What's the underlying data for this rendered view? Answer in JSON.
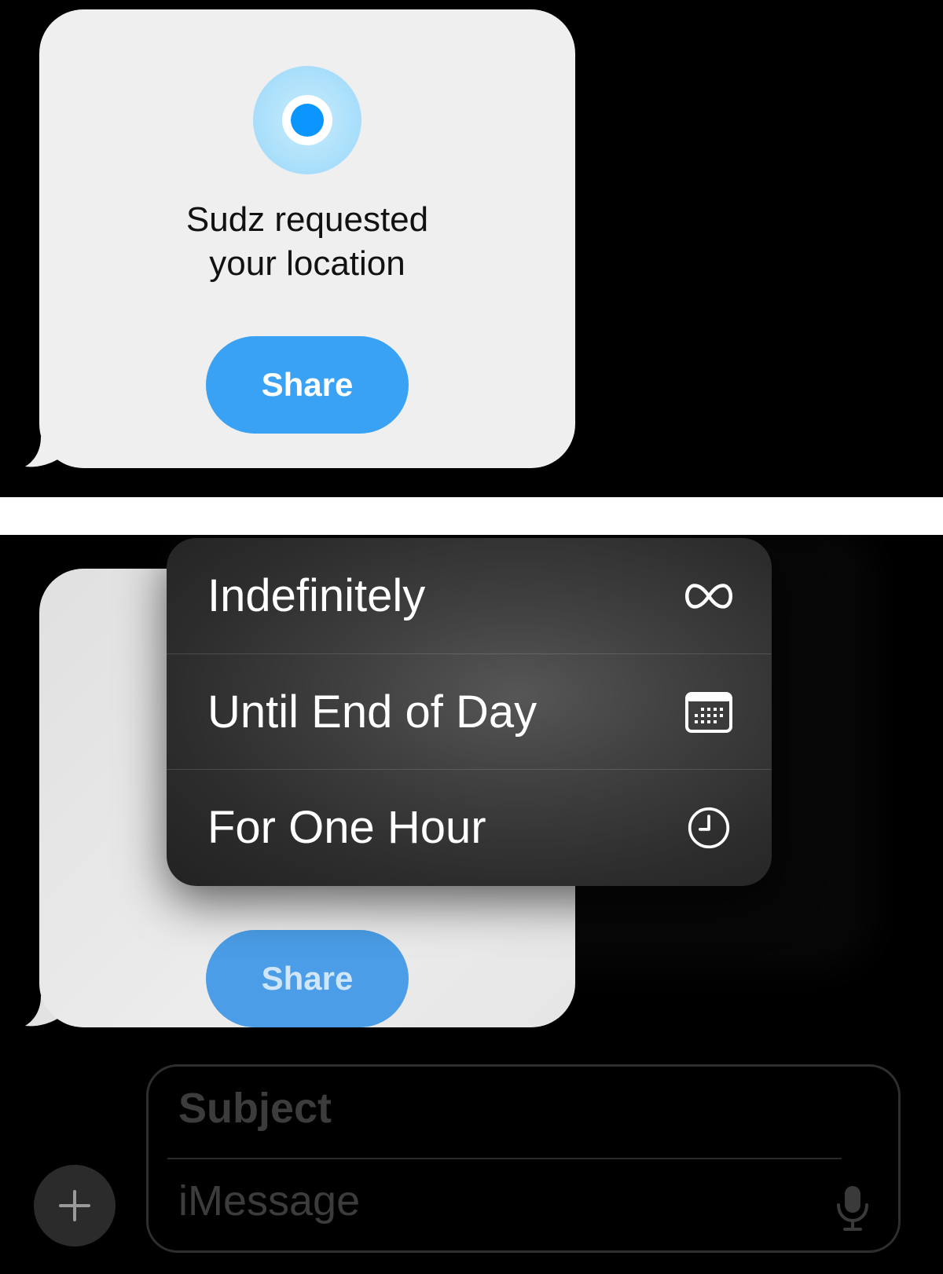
{
  "top_bubble": {
    "request_line1": "Sudz requested",
    "request_line2": "your location",
    "share_label": "Share"
  },
  "bottom_bubble": {
    "share_label": "Share"
  },
  "menu": {
    "items": [
      {
        "label": "Indefinitely",
        "icon": "infinity-icon"
      },
      {
        "label": "Until End of Day",
        "icon": "calendar-icon"
      },
      {
        "label": "For One Hour",
        "icon": "clock-icon"
      }
    ]
  },
  "compose": {
    "subject_placeholder": "Subject",
    "message_placeholder": "iMessage"
  },
  "colors": {
    "share_button": "#3aa2f5",
    "location_dot": "#0a95ff",
    "bubble": "#efefef",
    "menu_background": "#3f3f3f"
  }
}
